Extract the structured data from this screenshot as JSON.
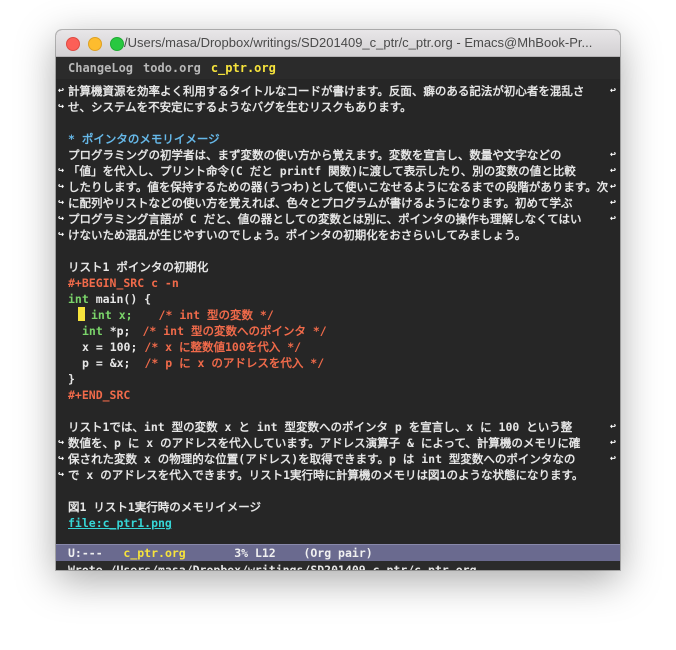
{
  "window": {
    "title": "/Users/masa/Dropbox/writings/SD201409_c_ptr/c_ptr.org - Emacs@MhBook-Pr..."
  },
  "tabs": [
    {
      "label": "ChangeLog",
      "active": false
    },
    {
      "label": "todo.org",
      "active": false
    },
    {
      "label": "c_ptr.org",
      "active": true
    }
  ],
  "body": {
    "p0_l1": "計算機資源を効率よく利用するタイトルなコードが書けます。反面、癖のある記法が初心者を混乱さ",
    "p0_l2": "せ、システムを不安定にするようなバグを生むリスクもあります。",
    "heading": "* ポインタのメモリイメージ",
    "p1_l1": "  プログラミングの初学者は、まず変数の使い方から覚えます。変数を宣言し、数量や文字などの",
    "p1_l2": "「値」を代入し、プリント命令(C だと printf 関数)に渡して表示したり、別の変数の値と比較",
    "p1_l3": "したりします。値を保持するための器(うつわ)として使いこなせるようになるまでの段階があります。次",
    "p1_l4": "に配列やリストなどの使い方を覚えれば、色々とプログラムが書けるようになります。初めて学ぶ",
    "p1_l5": "プログラミング言語が C だと、値の器としての変数とは別に、ポインタの操作も理解しなくてはい",
    "p1_l6": "けないため混乱が生じやすいのでしょう。ポインタの初期化をおさらいしてみましょう。",
    "listing_caption": "リスト1 ポインタの初期化",
    "src_begin": "#+BEGIN_SRC c -n",
    "code": {
      "l1_type": "int",
      "l1_rest": " main() {",
      "l2_code": "int x;",
      "l2_cmt": "/* int 型の変数 */",
      "l3_type": "int",
      "l3_code": " *p;",
      "l3_cmt": "/* int 型の変数へのポインタ */",
      "l4_code": "x = 100;",
      "l4_cmt": "/* x に整数値100を代入 */",
      "l5_code": "p = &x;",
      "l5_cmt": "/* p に x のアドレスを代入 */",
      "l6": "}"
    },
    "src_end": "#+END_SRC",
    "p2_l1": "  リスト1では、int 型の変数 x と int 型変数へのポインタ p を宣言し、x に 100 という整",
    "p2_l2": "数値を、p に x のアドレスを代入しています。アドレス演算子 & によって、計算機のメモリに確",
    "p2_l3": "保された変数  x の物理的な位置(アドレス)を取得できます。p は int 型変数へのポインタなの",
    "p2_l4": "で x のアドレスを代入できます。リスト1実行時に計算機のメモリは図1のような状態になります。",
    "figure_caption": "図1 リスト1実行時のメモリイメージ",
    "link": "file:c_ptr1.png"
  },
  "modeline": {
    "status": "U:---",
    "filename": "c_ptr.org",
    "position": "3% L12",
    "mode": "(Org pair)"
  },
  "minibuffer": "Wrote /Users/masa/Dropbox/writings/SD201409_c_ptr/c_ptr.org",
  "colors": {
    "background": "#262626",
    "heading": "#66b8e8",
    "meta": "#f06a4a",
    "type": "#7ad46a",
    "link": "#36d6d6",
    "active_tab": "#f6e33c",
    "modeline": "#6a6a8f"
  }
}
